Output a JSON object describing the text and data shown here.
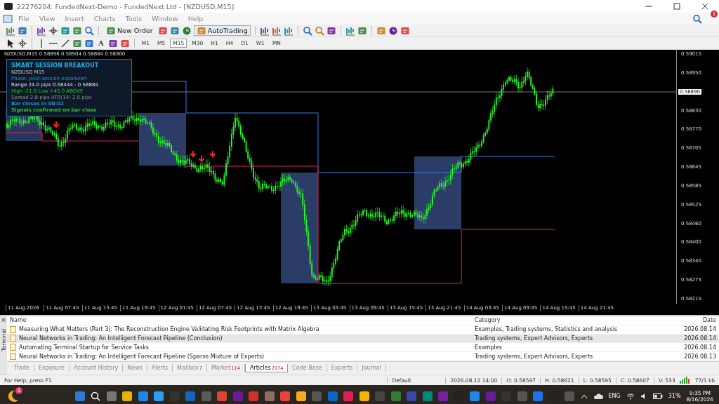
{
  "window": {
    "title": "22276204: FundedNext-Demo - FundedNext Ltd - [NZDUSD,M15]"
  },
  "menu": [
    "File",
    "View",
    "Insert",
    "Charts",
    "Tools",
    "Window",
    "Help"
  ],
  "notification_badge": "1",
  "toolbar": {
    "new_order": "New Order",
    "autotrading": "AutoTrading"
  },
  "drawing_tools": {
    "text_tool": "A"
  },
  "timeframes": [
    {
      "label": "M1",
      "selected": false
    },
    {
      "label": "M5",
      "selected": false
    },
    {
      "label": "M15",
      "selected": true
    },
    {
      "label": "M30",
      "selected": false
    },
    {
      "label": "H1",
      "selected": false
    },
    {
      "label": "H4",
      "selected": false
    },
    {
      "label": "D1",
      "selected": false
    },
    {
      "label": "W1",
      "selected": false
    },
    {
      "label": "MN",
      "selected": false
    }
  ],
  "chart": {
    "header": "NZDUSD,M15  0.58896 0.58904 0.58884 0.58900",
    "panel": {
      "title": "SMART SESSION BREAKOUT",
      "lines": [
        {
          "text": "NZDUSD  M15",
          "kind": "symbol"
        },
        {
          "text": "Phase: post-session expansion",
          "kind": "phase"
        },
        {
          "text": "Range 24.0 pips   0.58444 - 0.58884",
          "kind": "range"
        },
        {
          "text": "High -21.0   Low +45.0   ABOVE",
          "kind": "levels"
        },
        {
          "text": "Spread 2.8 pips   ATR(14) 2.0 pips",
          "kind": "spread"
        },
        {
          "text": "Bar closes in 00:02",
          "kind": "timer"
        },
        {
          "text": "Signals confirmed on bar close",
          "kind": "signal"
        }
      ]
    },
    "price_axis": [
      {
        "label": "0.59015",
        "current": false
      },
      {
        "label": "0.58950",
        "current": false
      },
      {
        "label": "0.58890",
        "current": true
      },
      {
        "label": "0.58830",
        "current": false
      },
      {
        "label": "0.58770",
        "current": false
      },
      {
        "label": "0.58705",
        "current": false
      },
      {
        "label": "0.58645",
        "current": false
      },
      {
        "label": "0.58585",
        "current": false
      },
      {
        "label": "0.58525",
        "current": false
      },
      {
        "label": "0.58460",
        "current": false
      },
      {
        "label": "0.58400",
        "current": false
      },
      {
        "label": "0.58340",
        "current": false
      },
      {
        "label": "0.58275",
        "current": false
      },
      {
        "label": "0.58215",
        "current": false
      }
    ],
    "time_axis": [
      "11 Aug 2026",
      "11 Aug 07:45",
      "11 Aug 13:45",
      "11 Aug 19:45",
      "12 Aug 01:45",
      "12 Aug 07:45",
      "12 Aug 13:45",
      "12 Aug 19:45",
      "13 Aug 03:45",
      "13 Aug 09:45",
      "13 Aug 15:45",
      "13 Aug 21:45",
      "14 Aug 03:45",
      "14 Aug 09:45",
      "14 Aug 15:45",
      "14 Aug 21:45"
    ]
  },
  "terminal": {
    "side_label": "Terminal",
    "close": "×",
    "columns": [
      "Name",
      "Category",
      "Date"
    ],
    "rows": [
      {
        "name": "Measuring What Matters (Part 3): The Reconstruction Engine  Validating Risk Footprints with Matrix Algebra",
        "category": "Examples, Trading systems, Statistics and analysis",
        "date": "2026.08.14",
        "selected": false
      },
      {
        "name": "Neural Networks in Trading: An Intelligent Forecast Pipeline (Conclusion)",
        "category": "Trading systems, Expert Advisors, Experts",
        "date": "2026.08.14",
        "selected": true
      },
      {
        "name": "Automating Terminal Startup for Service Tasks",
        "category": "Examples",
        "date": "2026.08.14",
        "selected": false
      },
      {
        "name": "Neural Networks in Trading: An Intelligent Forecast Pipeline (Sparse Mixture of Experts)",
        "category": "Trading systems, Expert Advisors, Experts",
        "date": "2026.08.13",
        "selected": false
      }
    ],
    "tabs": [
      {
        "label": "Trade",
        "selected": false
      },
      {
        "label": "Exposure",
        "selected": false
      },
      {
        "label": "Account History",
        "selected": false
      },
      {
        "label": "News",
        "selected": false
      },
      {
        "label": "Alerts",
        "selected": false
      },
      {
        "label": "Mailbox",
        "count": "7",
        "selected": false
      },
      {
        "label": "Market",
        "count": "114",
        "selected": false
      },
      {
        "label": "Articles",
        "count": "2974",
        "selected": true
      },
      {
        "label": "Code Base",
        "selected": false
      },
      {
        "label": "Experts",
        "selected": false
      },
      {
        "label": "Journal",
        "selected": false
      }
    ]
  },
  "status_bar": {
    "help": "For Help, press F1",
    "profile": "Default",
    "time": "2026.08.12 14:00",
    "open": "O: 0.58597",
    "high": "H: 0.58621",
    "low": "L: 0.58595",
    "close": "C: 0.58607",
    "volume": "V: 533",
    "traffic": "77/1 kb"
  },
  "taskbar": {
    "weather_badge": "1",
    "language": "ENG",
    "battery": "31%",
    "clock": "9:35 PM",
    "date": "8/16/2026"
  }
}
